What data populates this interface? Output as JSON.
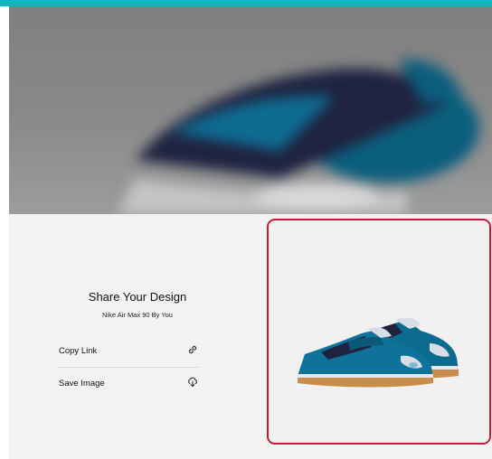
{
  "share": {
    "title": "Share Your Design",
    "subtitle": "Nike Air Max 90 By You"
  },
  "actions": [
    {
      "label": "Copy Link",
      "icon": "link-icon"
    },
    {
      "label": "Save Image",
      "icon": "download-icon"
    }
  ],
  "colors": {
    "accent": "#14b3c2",
    "highlight_border": "#c8193c",
    "shoe_blue": "#0e6b90",
    "shoe_navy": "#1f2340",
    "gum_sole": "#c98d4b"
  }
}
